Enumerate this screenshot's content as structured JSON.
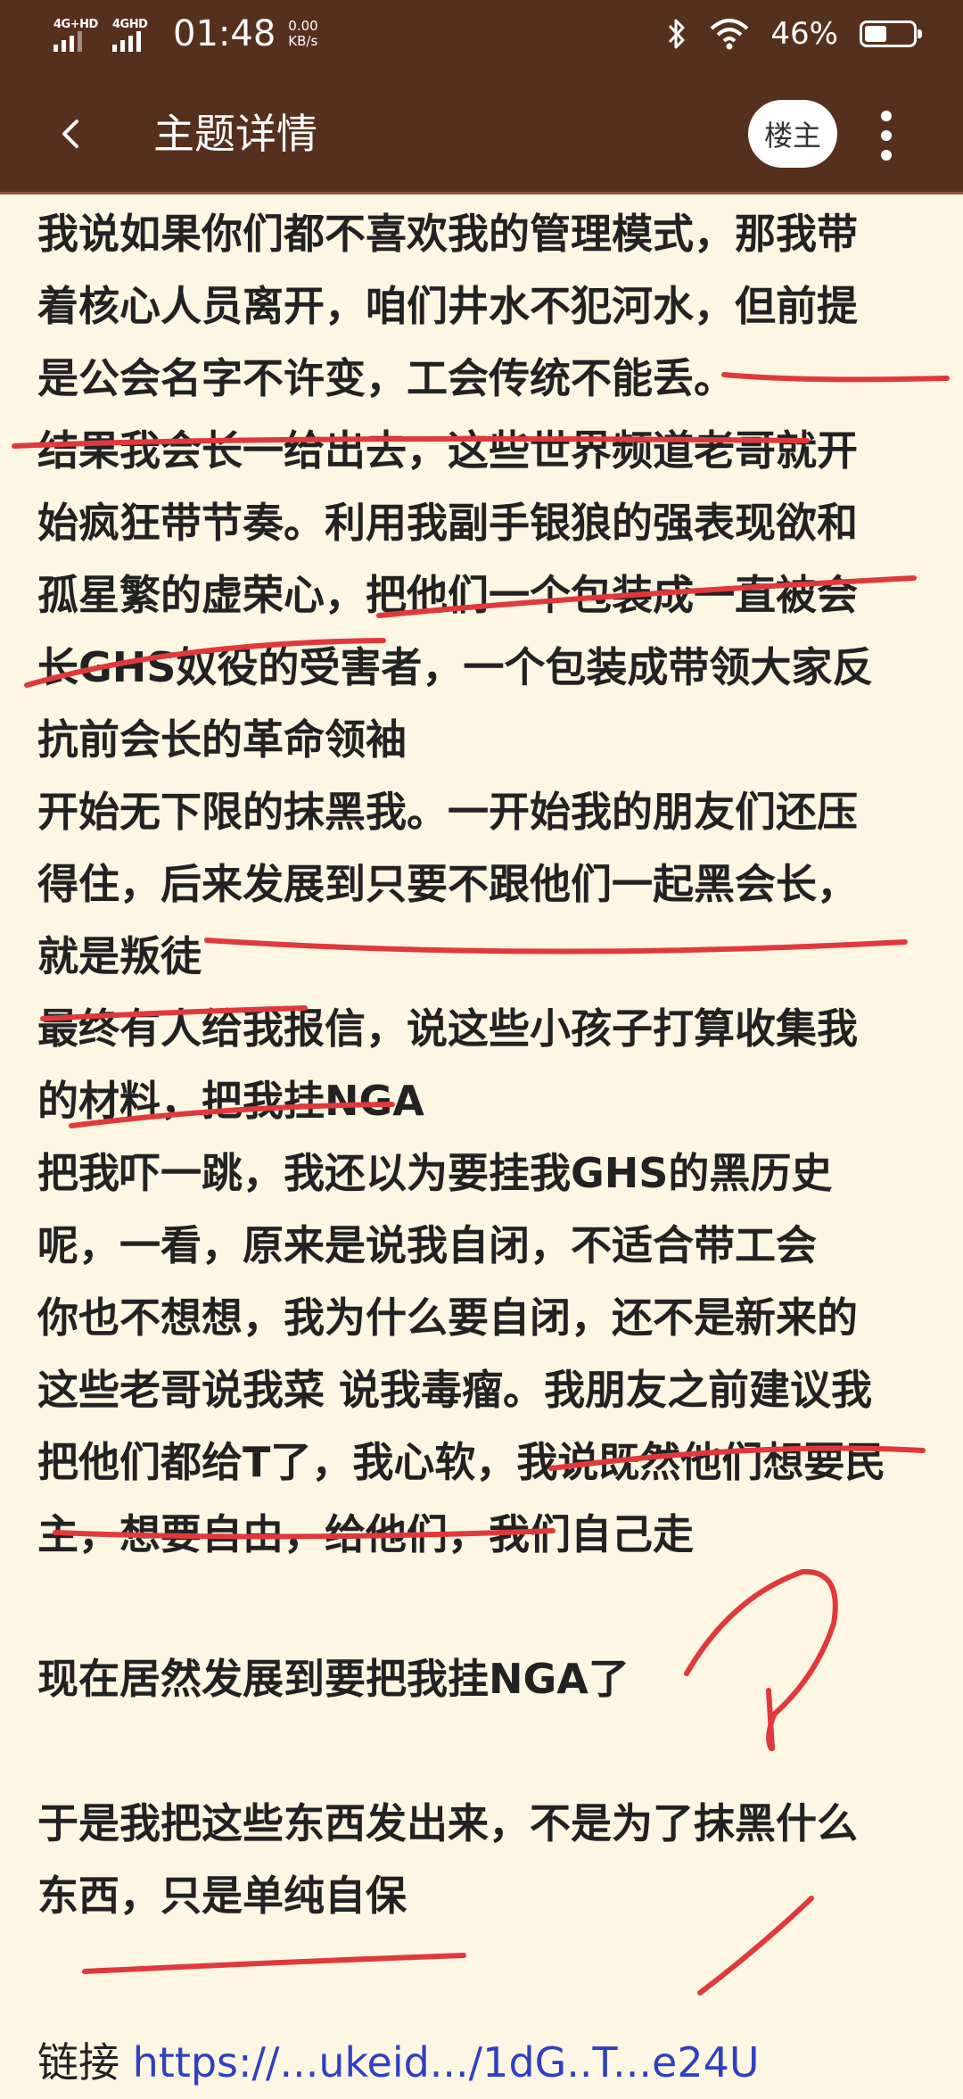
{
  "status_bar": {
    "network1": "4G+HD",
    "network2": "4GHD",
    "time": "01:48",
    "speed_value": "0.00",
    "speed_unit": "KB/s",
    "battery_pct": "46%",
    "battery_level": 0.46
  },
  "header": {
    "title": "主题详情",
    "op_button": "楼主"
  },
  "post": {
    "lines": [
      "我说如果你们都不喜欢我的管理模式，那我带",
      "着核心人员离开，咱们井水不犯河水，但前提",
      "是公会名字不许变，工会传统不能丢。",
      "结果我会长一给出去，这些世界频道老哥就开",
      "始疯狂带节奏。利用我副手银狼的强表现欲和",
      "孤星繁的虚荣心，把他们一个包装成一直被会",
      "长GHS奴役的受害者，一个包装成带领大家反",
      "抗前会长的革命领袖",
      "开始无下限的抹黑我。一开始我的朋友们还压",
      "得住，后来发展到只要不跟他们一起黑会长，",
      "就是叛徒",
      "最终有人给我报信，说这些小孩子打算收集我",
      "的材料，把我挂NGA",
      "把我吓一跳，我还以为要挂我GHS的黑历史",
      "呢，一看，原来是说我自闭，不适合带工会",
      "你也不想想，我为什么要自闭，还不是新来的",
      "这些老哥说我菜 说我毒瘤。我朋友之前建议我",
      "把他们都给T了，我心软，我说既然他们想要民",
      "主，想要自由，给他们，我们自己走",
      "",
      "现在居然发展到要把我挂NGA了",
      "",
      "于是我把这些东西发出来，不是为了抹黑什么",
      "东西，只是单纯自保"
    ],
    "link_label": "链接",
    "link_text": "https://...ukeid.../1dG..T...e24U"
  },
  "colors": {
    "header_bg": "#55301d",
    "page_bg": "#fdf6e3",
    "annotation": "#e0393c"
  }
}
